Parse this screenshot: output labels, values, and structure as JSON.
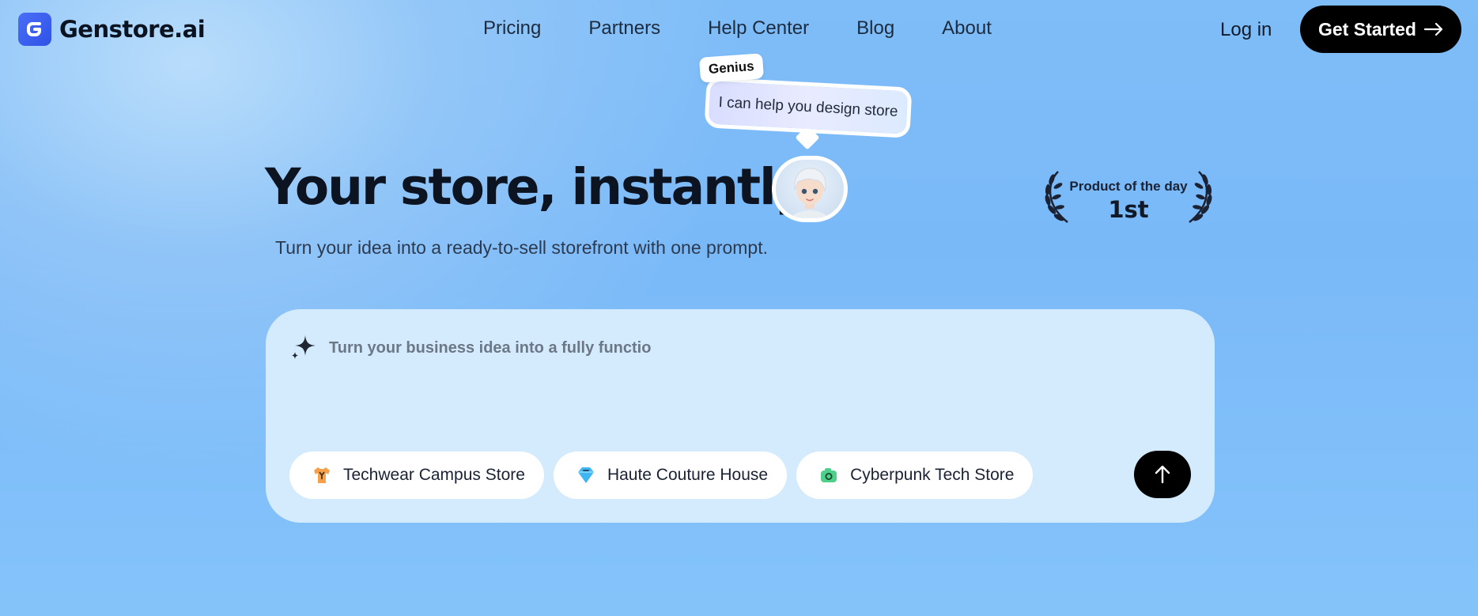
{
  "header": {
    "brand": "Genstore.ai",
    "nav": [
      "Pricing",
      "Partners",
      "Help Center",
      "Blog",
      "About"
    ],
    "login_label": "Log in",
    "cta_label": "Get Started"
  },
  "assistant": {
    "tag": "Genius",
    "message": "I can help you design store"
  },
  "hero": {
    "title": "Your store, instantly.",
    "subtitle": "Turn your idea into a ready-to-sell storefront with one prompt."
  },
  "award": {
    "label": "Product of the day",
    "rank": "1st"
  },
  "prompt_card": {
    "input_value": "Turn your business idea into a fully functio",
    "suggestions": [
      {
        "label": "Techwear Campus Store",
        "icon": "shirt-icon",
        "color": "#f5a04a"
      },
      {
        "label": "Haute Couture House",
        "icon": "gem-icon",
        "color": "#3fb6f2"
      },
      {
        "label": "Cyberpunk Tech Store",
        "icon": "camera-icon",
        "color": "#4fd08a"
      }
    ]
  },
  "colors": {
    "brand": "#3b5ef0",
    "cta_bg": "#000000",
    "card_bg": "#d3ebfd"
  }
}
